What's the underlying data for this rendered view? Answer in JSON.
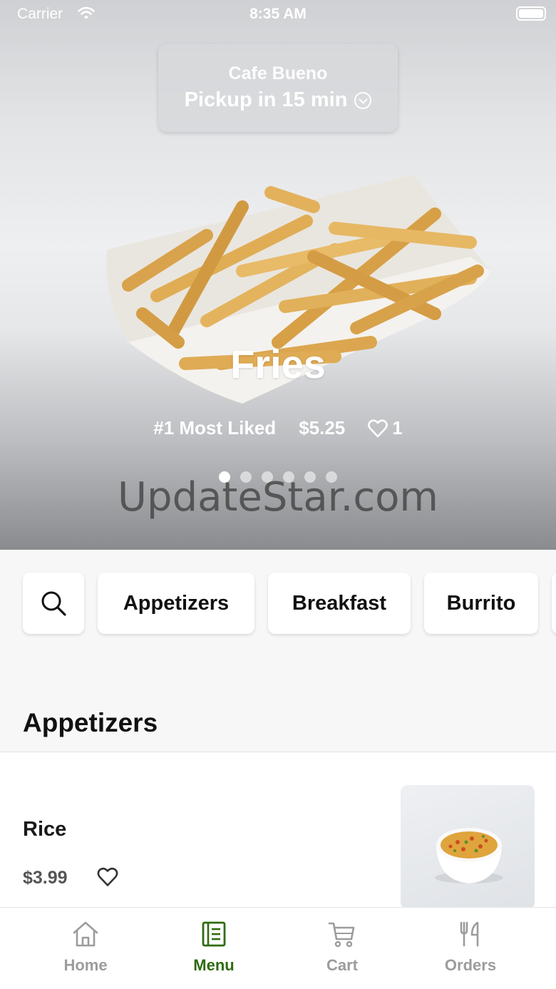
{
  "status_bar": {
    "carrier": "Carrier",
    "time": "8:35 AM"
  },
  "pickup": {
    "restaurant": "Cafe Bueno",
    "time_label": "Pickup in 15 min"
  },
  "featured": {
    "title": "Fries",
    "rank": "#1 Most Liked",
    "price": "$5.25",
    "likes": "1",
    "slide_count": 6,
    "active_slide": 1
  },
  "watermark": "UpdateStar.com",
  "categories": [
    "Appetizers",
    "Breakfast",
    "Burrito"
  ],
  "section": {
    "title": "Appetizers"
  },
  "menu_items": [
    {
      "name": "Rice",
      "price": "$3.99"
    }
  ],
  "tabs": [
    {
      "label": "Home",
      "icon": "home-icon"
    },
    {
      "label": "Menu",
      "icon": "menu-icon"
    },
    {
      "label": "Cart",
      "icon": "cart-icon"
    },
    {
      "label": "Orders",
      "icon": "orders-icon"
    }
  ],
  "active_tab": "Menu",
  "colors": {
    "accent": "#2f6b10",
    "tab_inactive": "#9c9c9c"
  }
}
